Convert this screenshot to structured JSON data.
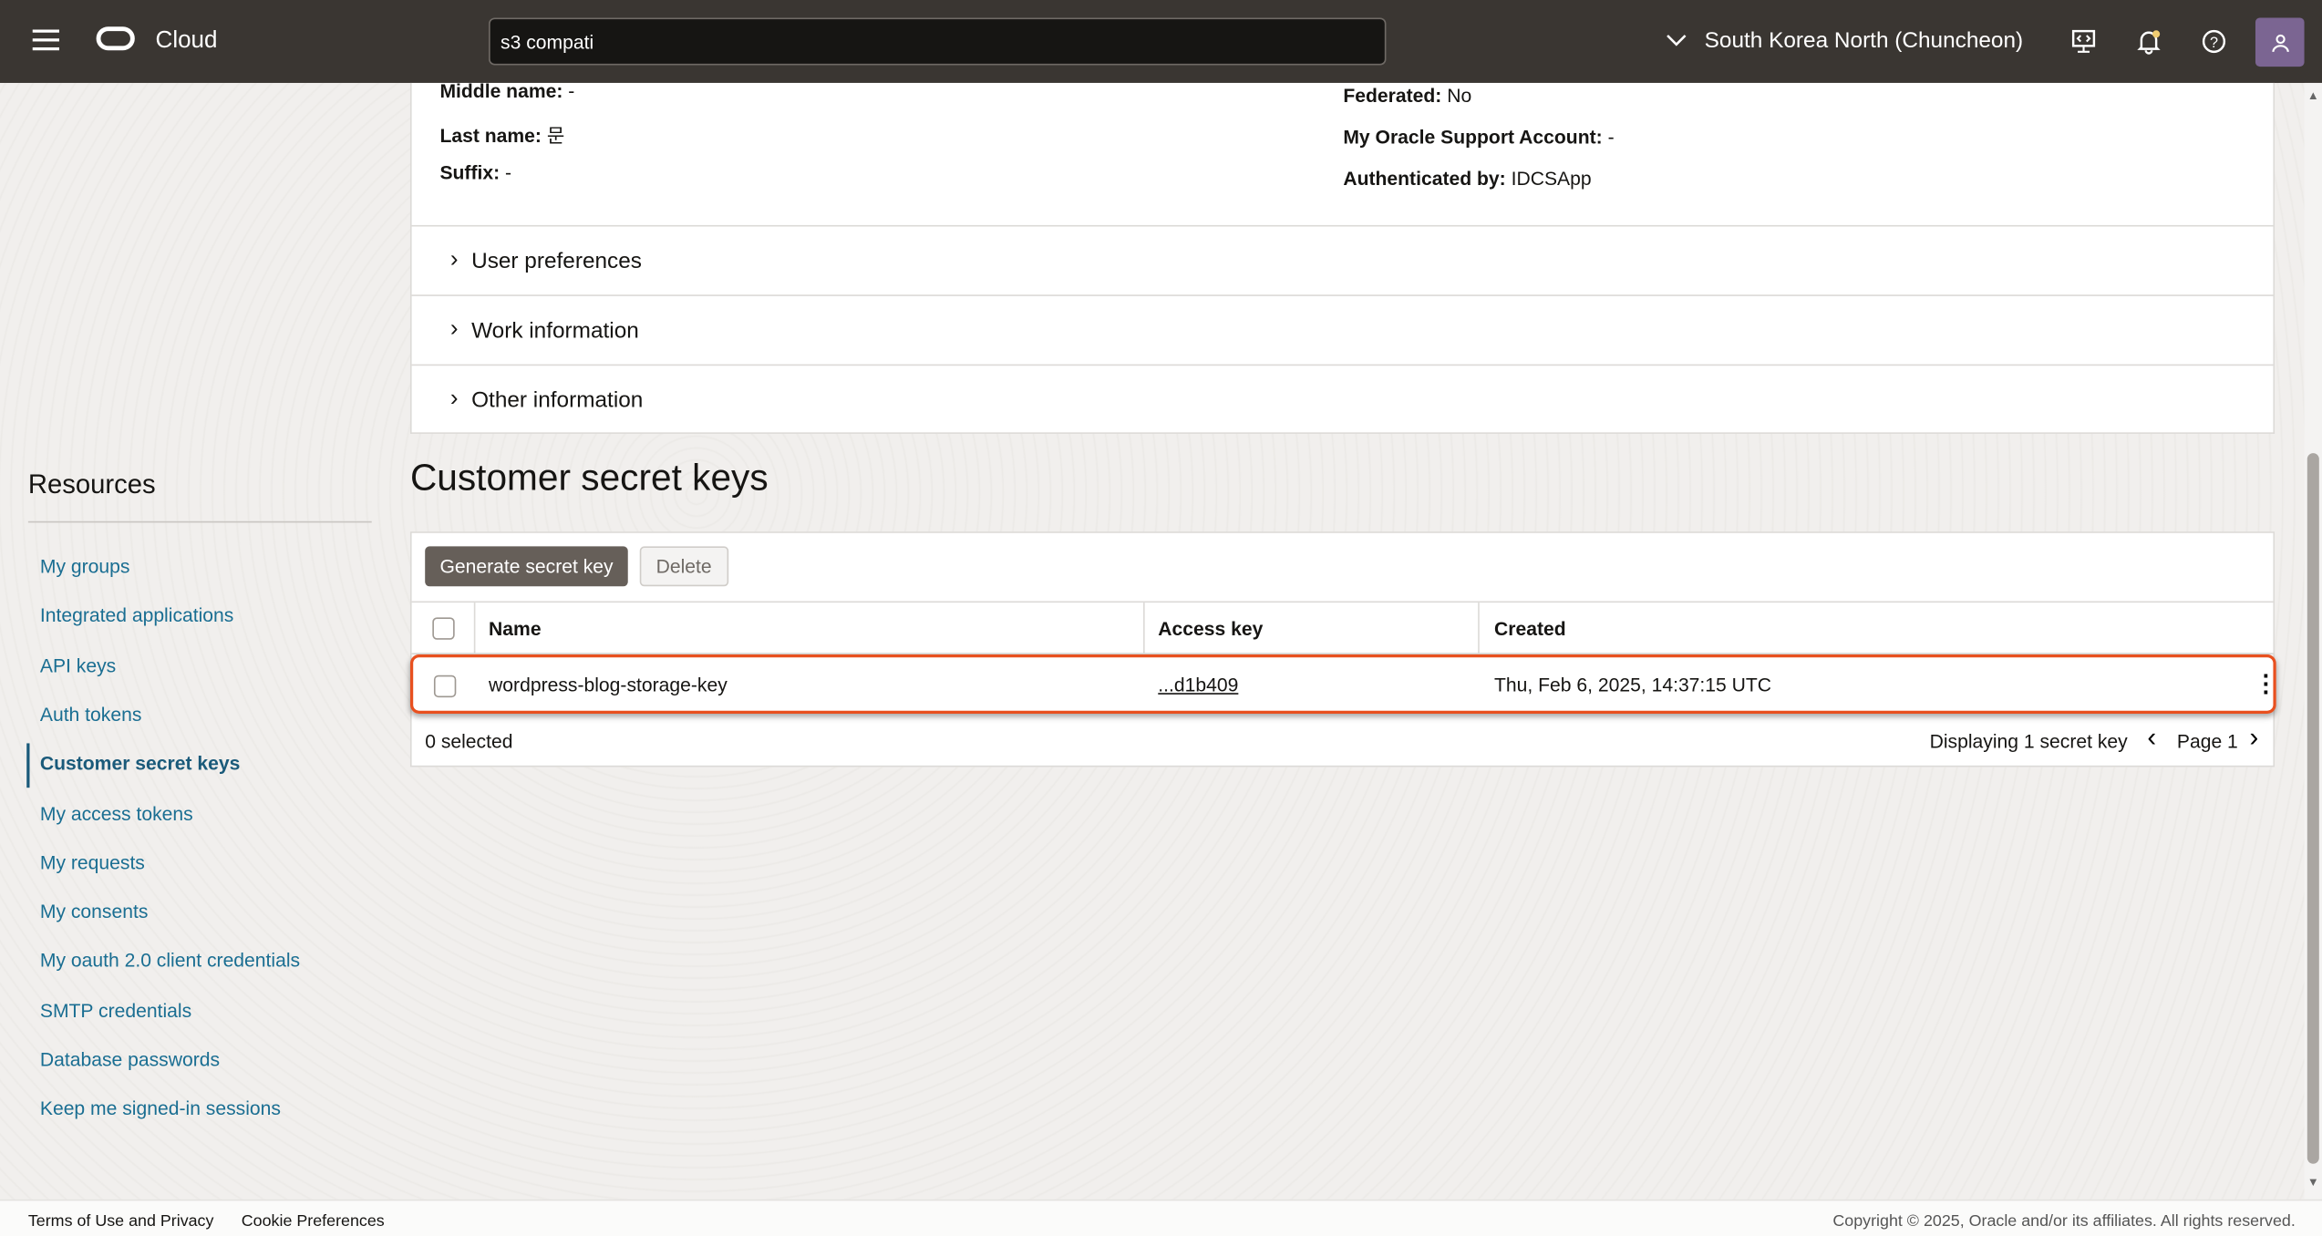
{
  "header": {
    "brand": "Cloud",
    "search_value": "s3 compati",
    "region": "South Korea North (Chuncheon)",
    "icons": [
      "menu-icon",
      "oracle-logo",
      "chevron-down-icon",
      "cloud-shell-icon",
      "bell-icon",
      "help-icon",
      "user-icon"
    ]
  },
  "details": {
    "middle_name_label": "Middle name:",
    "middle_name": "-",
    "last_name_label": "Last name:",
    "last_name": "문",
    "suffix_label": "Suffix:",
    "suffix": "-",
    "federated_label": "Federated:",
    "federated": "No",
    "support_label": "My Oracle Support Account:",
    "support": "-",
    "auth_label": "Authenticated by:",
    "auth": "IDCSApp"
  },
  "sections": [
    "User preferences",
    "Work information",
    "Other information"
  ],
  "resources": {
    "title": "Resources",
    "items": [
      "My groups",
      "Integrated applications",
      "API keys",
      "Auth tokens",
      "Customer secret keys",
      "My access tokens",
      "My requests",
      "My consents",
      "My oauth 2.0 client credentials",
      "SMTP credentials",
      "Database passwords",
      "Keep me signed-in sessions"
    ],
    "active": "Customer secret keys"
  },
  "main": {
    "title": "Customer secret keys",
    "generate_label": "Generate secret key",
    "delete_label": "Delete",
    "columns": [
      "Name",
      "Access key",
      "Created"
    ],
    "rows": [
      {
        "name": "wordpress-blog-storage-key",
        "access_key": "...d1b409",
        "created": "Thu, Feb 6, 2025, 14:37:15 UTC"
      }
    ],
    "selected": "0 selected",
    "displaying": "Displaying 1 secret key",
    "page": "Page 1"
  },
  "footer": {
    "terms": "Terms of Use and Privacy",
    "cookies": "Cookie Preferences",
    "copyright": "Copyright © 2025, Oracle and/or its affiliates. All rights reserved."
  },
  "colors": {
    "header": "#3a3632",
    "link": "#1a6e92",
    "highlight": "#e8501f",
    "primary_button": "#665f59"
  }
}
